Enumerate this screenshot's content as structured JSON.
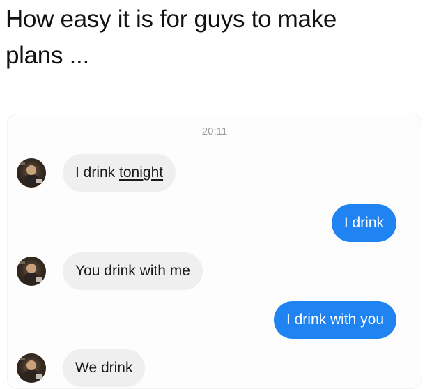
{
  "caption": {
    "line1": "How easy it is for guys to make",
    "line2": "plans ..."
  },
  "chat": {
    "timestamp": "20:11",
    "messages": [
      {
        "sender": "them",
        "text_plain": "I drink ",
        "text_underlined": "tonight"
      },
      {
        "sender": "me",
        "text": "I drink"
      },
      {
        "sender": "them",
        "text": "You drink with me"
      },
      {
        "sender": "me",
        "text": "I drink with you"
      },
      {
        "sender": "them",
        "text": "We drink"
      }
    ]
  },
  "colors": {
    "outgoing_bubble": "#1f84f2",
    "incoming_bubble": "#efefef",
    "timestamp": "#9c9c9c"
  },
  "icons": {
    "avatar": "contact-avatar-photo"
  }
}
